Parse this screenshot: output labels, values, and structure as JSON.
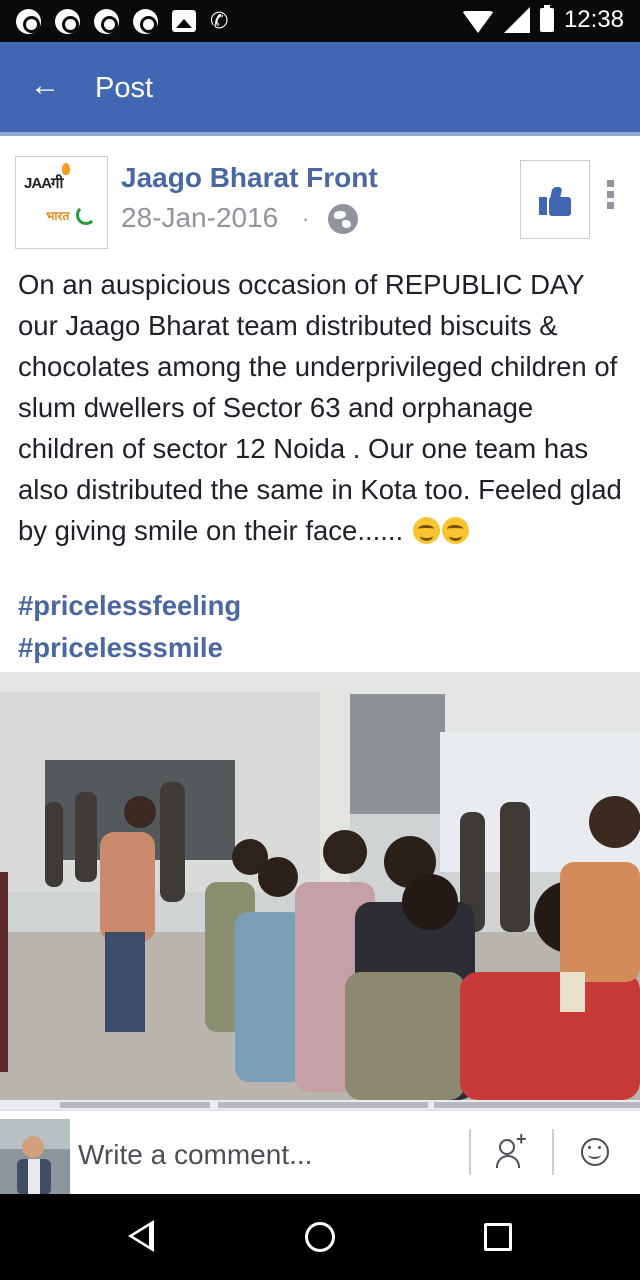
{
  "status_bar": {
    "time": "12:38",
    "notification_icons": [
      "chrome-icon",
      "chrome-icon",
      "chrome-icon",
      "chrome-icon",
      "image-icon",
      "missed-call-icon"
    ]
  },
  "app_bar": {
    "title": "Post",
    "color": "#4267b2"
  },
  "post": {
    "page_name": "Jaago Bharat Front",
    "date": "28-Jan-2016",
    "separator": "·",
    "logo_text_top": "JAAगी",
    "logo_text_bottom": "भारत",
    "body": "On an auspicious occasion of REPUBLIC DAY our Jaago Bharat team distributed biscuits & chocolates among the underprivileged children of slum dwellers of Sector 63 and orphanage children of sector 12 Noida . Our one team has also distributed the same in Kota too. Feeled glad by giving smile on their face......",
    "hashtags": [
      "#pricelessfeeling",
      "#pricelesssmile"
    ]
  },
  "comment_bar": {
    "placeholder": "Write a comment..."
  },
  "colors": {
    "link": "#4b67a1",
    "meta": "#90949c",
    "text": "#1d2129"
  }
}
